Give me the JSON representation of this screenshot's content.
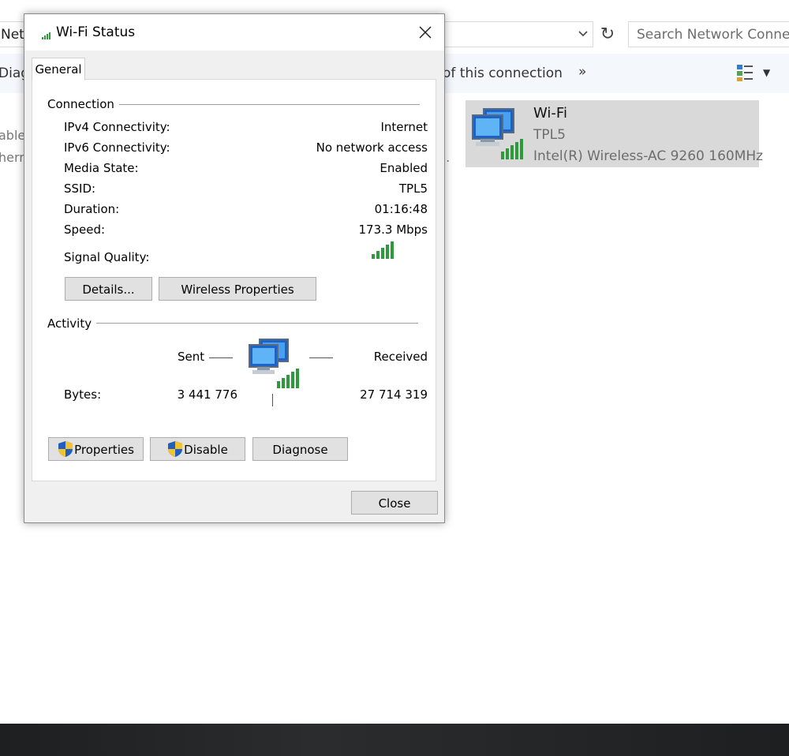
{
  "explorer": {
    "address_text": "Netwo",
    "search_placeholder": "Search Network Connect",
    "toolbar_left": "Diagn",
    "toolbar_mid": "of this connection",
    "toolbar_more": "»",
    "left_line_1": "able",
    "left_line_2": "hern",
    "dots": "..",
    "wifi_card": {
      "name": "Wi-Fi",
      "ssid": "TPL5",
      "adapter": "Intel(R) Wireless-AC 9260 160MHz"
    }
  },
  "dialog": {
    "title": "Wi-Fi Status",
    "tab_general": "General",
    "connection": {
      "heading": "Connection",
      "rows": [
        {
          "label": "IPv4 Connectivity:",
          "value": "Internet"
        },
        {
          "label": "IPv6 Connectivity:",
          "value": "No network access"
        },
        {
          "label": "Media State:",
          "value": "Enabled"
        },
        {
          "label": "SSID:",
          "value": "TPL5"
        },
        {
          "label": "Duration:",
          "value": "01:16:48"
        },
        {
          "label": "Speed:",
          "value": "173.3 Mbps"
        }
      ],
      "signal_label": "Signal Quality:",
      "signal_bars": 5
    },
    "buttons": {
      "details": "Details...",
      "wireless_properties": "Wireless Properties",
      "properties": "Properties",
      "disable": "Disable",
      "diagnose": "Diagnose",
      "close": "Close"
    },
    "activity": {
      "heading": "Activity",
      "sent_label": "Sent",
      "received_label": "Received",
      "bytes_label": "Bytes:",
      "bytes_sent": "3 441 776",
      "bytes_received": "27 714 319"
    }
  },
  "colors": {
    "signal_green": "#2e9a3c",
    "selection_bg": "#d9d9d9",
    "button_face": "#e1e1e1"
  }
}
